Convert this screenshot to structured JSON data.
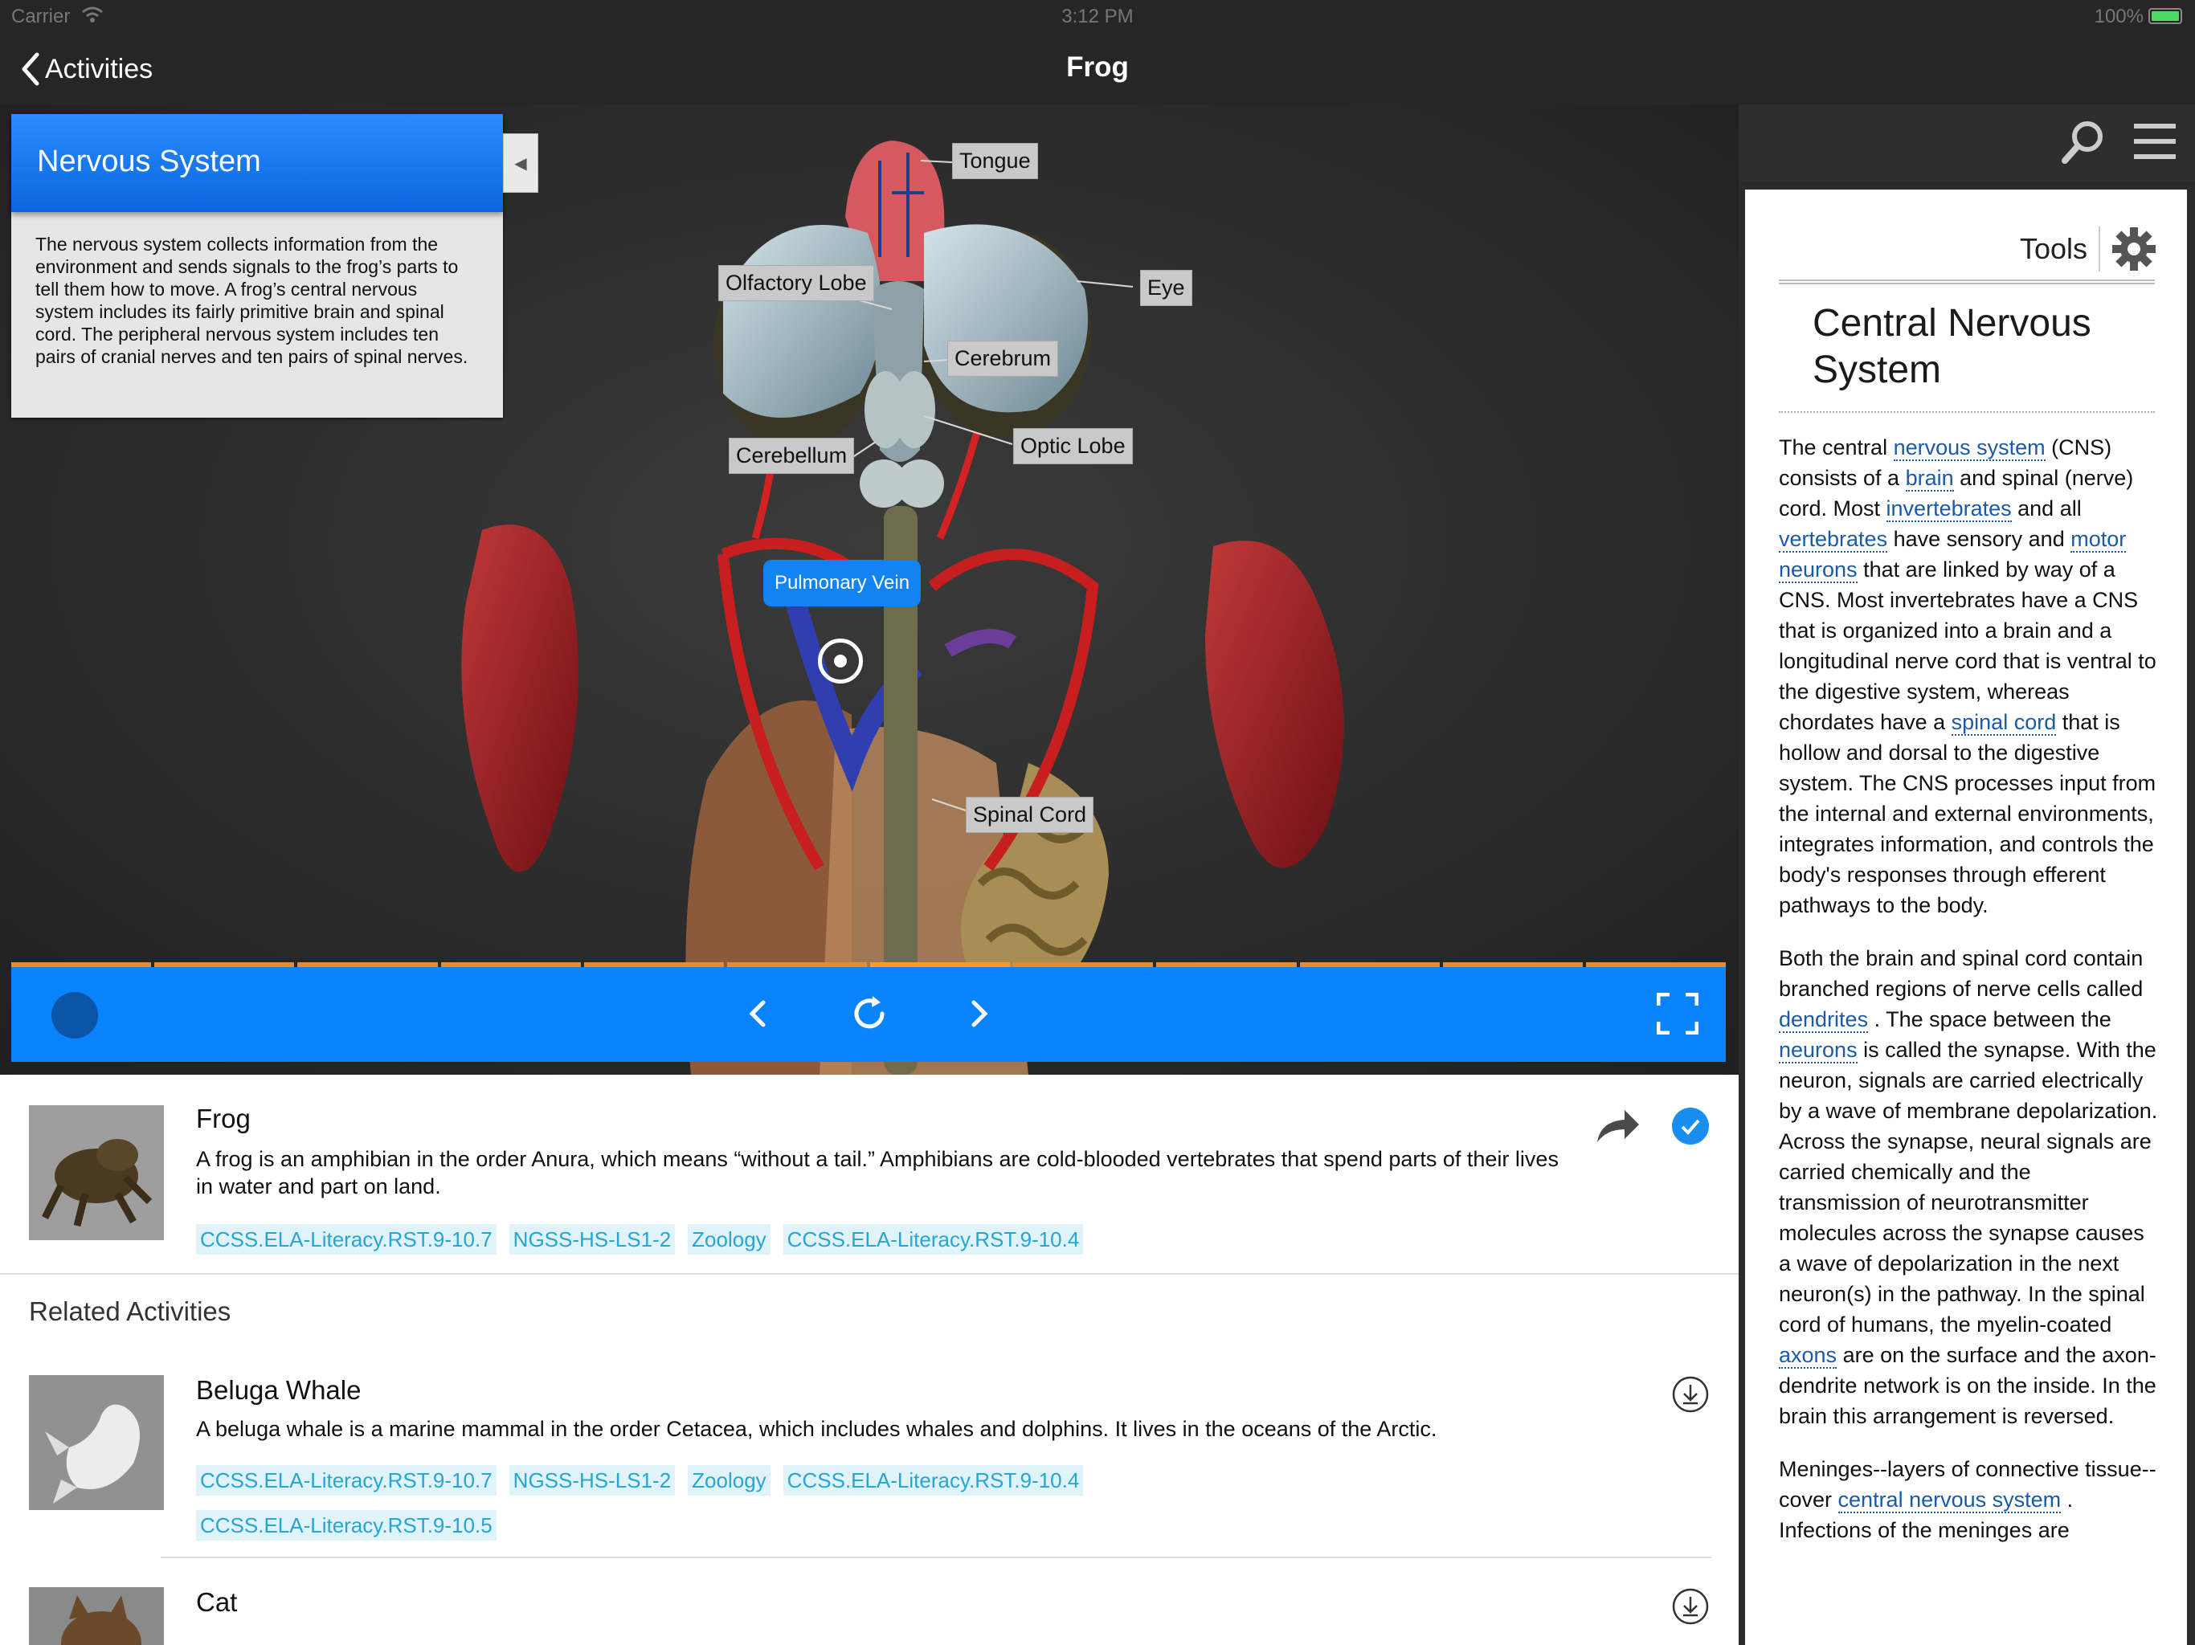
{
  "status_bar": {
    "carrier": "Carrier",
    "time": "3:12 PM",
    "battery": "100%"
  },
  "nav": {
    "back_label": "Activities",
    "title": "Frog"
  },
  "info_panel": {
    "title": "Nervous System",
    "text": "The nervous system collects information from the environment and sends signals to the frog’s parts to tell them how to move. A frog’s central nervous system includes its fairly primitive brain and spinal cord. The peripheral nervous system includes ten pairs of cranial nerves and ten pairs of spinal nerves."
  },
  "model_labels": {
    "tongue": "Tongue",
    "olfactory_lobe": "Olfactory Lobe",
    "eye": "Eye",
    "cerebrum": "Cerebrum",
    "cerebellum": "Cerebellum",
    "optic_lobe": "Optic Lobe",
    "pulmonary_vein": "Pulmonary Vein",
    "spinal_cord": "Spinal Cord"
  },
  "player": {
    "total_steps": 12,
    "active_step": 7
  },
  "right_panel": {
    "tools_label": "Tools",
    "title": "Central Nervous System",
    "paragraphs": [
      [
        {
          "t": "The central "
        },
        {
          "t": "nervous system",
          "link": true
        },
        {
          "t": " (CNS) consists of a "
        },
        {
          "t": "brain",
          "link": true
        },
        {
          "t": " and spinal (nerve) cord. Most "
        },
        {
          "t": "invertebrates",
          "link": true
        },
        {
          "t": " and all "
        },
        {
          "t": "vertebrates",
          "link": true
        },
        {
          "t": " have sensory and "
        },
        {
          "t": "motor neurons",
          "link": true
        },
        {
          "t": " that are linked by way of a CNS. Most invertebrates have a CNS that is organized into a brain and a longitudinal nerve cord that is ventral to the digestive system, whereas chordates have a "
        },
        {
          "t": "spinal cord",
          "link": true
        },
        {
          "t": " that is hollow and dorsal to the digestive system. The CNS processes input from the internal and external environments, integrates information, and controls the body's responses through efferent pathways to the body."
        }
      ],
      [
        {
          "t": "Both the brain and spinal cord contain branched regions of nerve cells called "
        },
        {
          "t": "dendrites",
          "link": true
        },
        {
          "t": " . The space between the "
        },
        {
          "t": "neurons",
          "link": true
        },
        {
          "t": " is called the synapse. With the neuron, signals are carried electrically by a wave of membrane depolarization. Across the synapse, neural signals are carried chemically and the transmission of neurotransmitter molecules across the synapse causes a wave of depolarization in the next neuron(s) in the pathway. In the spinal cord of humans, the myelin-coated "
        },
        {
          "t": "axons",
          "link": true
        },
        {
          "t": " are on the surface and the axon-dendrite network is on the inside. In the brain this arrangement is reversed."
        }
      ],
      [
        {
          "t": "Meninges--layers of connective tissue--cover "
        },
        {
          "t": "central nervous system",
          "link": true
        },
        {
          "t": " . Infections of the meninges are"
        }
      ]
    ]
  },
  "current_activity": {
    "title": "Frog",
    "description": "A frog is an amphibian in the order Anura, which means “without a tail.” Amphibians are cold-blooded vertebrates that spend parts of their lives in water and part on land.",
    "tags": [
      "CCSS.ELA-Literacy.RST.9-10.7",
      "NGSS-HS-LS1-2",
      "Zoology",
      "CCSS.ELA-Literacy.RST.9-10.4"
    ]
  },
  "related_heading": "Related Activities",
  "related": [
    {
      "title": "Beluga Whale",
      "description": "A beluga whale is a marine mammal in the order Cetacea, which includes whales and dolphins. It lives in the oceans of the Arctic.",
      "tags": [
        "CCSS.ELA-Literacy.RST.9-10.7",
        "NGSS-HS-LS1-2",
        "Zoology",
        "CCSS.ELA-Literacy.RST.9-10.4",
        "CCSS.ELA-Literacy.RST.9-10.5"
      ]
    },
    {
      "title": "Cat"
    }
  ],
  "colors": {
    "accent_blue": "#0a83ff",
    "tag_text": "#27a5d3",
    "tag_bg": "#dff3f8",
    "progress": "#e88a2f"
  }
}
